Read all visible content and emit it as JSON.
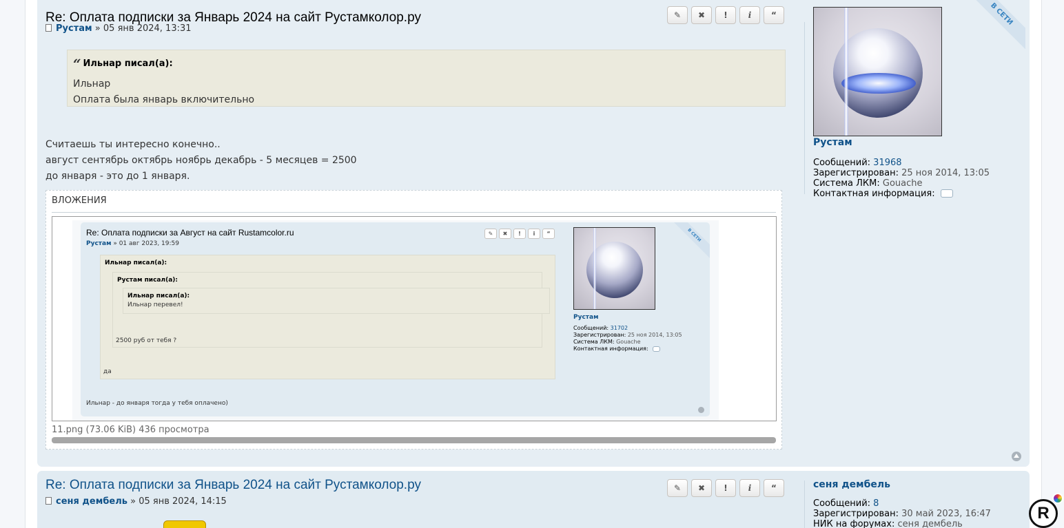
{
  "post1": {
    "title": "Re: Оплата подписки за Январь 2024 на сайт Рустамколор.ру",
    "author": "Рустам",
    "separator": "»",
    "date": "05 янв 2024, 13:31",
    "buttons": {
      "edit": "✎",
      "delete": "✖",
      "report": "!",
      "info": "i",
      "quote": "“"
    },
    "quote": {
      "mark": "“",
      "cite": "Ильнар писал(а):",
      "lines": [
        "Ильнар",
        "Оплата была январь включительно"
      ]
    },
    "content": [
      "Считаешь ты интересно конечно..",
      "август сентябрь октябрь ноябрь декабрь - 5 месяцев = 2500",
      "до января - это до 1 января."
    ],
    "attachments": {
      "header": "ВЛОЖЕНИЯ",
      "file_info": "11.png (73.06 KiB) 436 просмотра",
      "screenshot": {
        "title": "Re: Оплата подписки за Август на сайт Rustamcolor.ru",
        "author": "Рустам",
        "date": "» 01 авг 2023, 19:59",
        "buttons": [
          "✎",
          "✖",
          "!",
          "i",
          "“"
        ],
        "quote1_cite": "Ильнар писал(а):",
        "quote2_cite": "Рустам писал(а):",
        "quote3_cite": "Ильнар писал(а):",
        "quote3_text": "Ильнар перевел!",
        "quote2_text": "2500 руб от тебя ?",
        "quote1_text": "да",
        "body_text": "Ильнар - до января тогда у тебя оплачено)",
        "profile_name": "Рустам",
        "online_badge": "В СЕТИ",
        "posts_label": "Сообщений:",
        "posts_value": "31702",
        "registered_label": "Зарегистрирован:",
        "registered_value": "25 ноя 2014, 13:05",
        "system_label": "Система ЛКМ:",
        "system_value": "Gouache",
        "contact_label": "Контактная информация:"
      }
    },
    "profile": {
      "online_badge": "В СЕТИ",
      "name": "Рустам",
      "posts_label": "Сообщений:",
      "posts_value": "31968",
      "registered_label": "Зарегистрирован:",
      "registered_value": "25 ноя 2014, 13:05",
      "system_label": "Система ЛКМ:",
      "system_value": "Gouache",
      "contact_label": "Контактная информация:"
    }
  },
  "post2": {
    "title": "Re: Оплата подписки за Январь 2024 на сайт Рустамколор.ру",
    "author": "сеня дембель",
    "separator": "»",
    "date": "05 янв 2024, 14:15",
    "buttons": {
      "edit": "✎",
      "delete": "✖",
      "report": "!",
      "info": "i",
      "quote": "“"
    },
    "profile": {
      "name": "сеня дембель",
      "posts_label": "Сообщений:",
      "posts_value": "8",
      "registered_label": "Зарегистрирован:",
      "registered_value": "30 май 2023, 16:47",
      "nick_label": "НИК на форумах:",
      "nick_value": "сеня дембель"
    }
  },
  "overlay": {
    "registered_mark": "R"
  },
  "colors": {
    "link": "#105289",
    "post_bg": "#e1ebf2",
    "quote_bg": "#ebeadd",
    "badge_text": "#3b86c2"
  }
}
